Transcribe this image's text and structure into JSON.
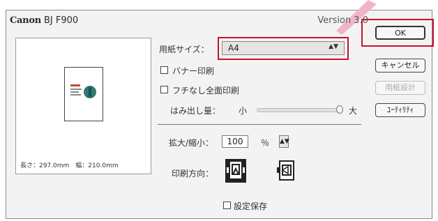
{
  "window": {
    "brand_bold": "Canon",
    "brand_model": "BJ F900",
    "version": "Version 3.0"
  },
  "preview": {
    "dims": "長さ：297.0mm　幅：210.0mm"
  },
  "paper_size": {
    "label": "用紙サイズ：",
    "selected": "A4"
  },
  "options": {
    "banner_print": "バナー印刷",
    "borderless_print": "フチなし全面印刷",
    "extension_label": "はみ出し量：",
    "extension_min": "小",
    "extension_max": "大"
  },
  "scaling": {
    "label": "拡大/縮小：",
    "value": "100",
    "unit": "％"
  },
  "orientation": {
    "label": "印刷方向："
  },
  "save_settings": "設定保存",
  "buttons": {
    "ok": "OK",
    "cancel": "キャンセル",
    "paper_custom": "用紙設計",
    "utility": "ﾕｰﾃｨﾘﾃｨ"
  },
  "colors": {
    "highlight": "#c8102e",
    "callout": "#f0b4cc"
  }
}
